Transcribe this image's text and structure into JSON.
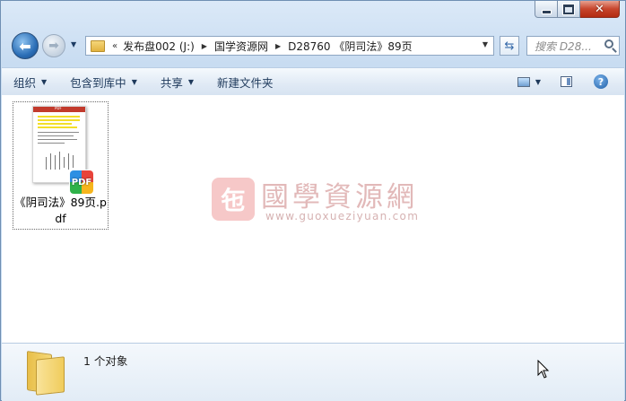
{
  "window": {
    "caption_buttons": {
      "minimize": "",
      "maximize": "",
      "close": "✕"
    }
  },
  "nav": {
    "breadcrumb_chevron": "«",
    "breadcrumb": [
      "发布盘002 (J:)",
      "国学资源网",
      "D28760 《阴司法》89页"
    ],
    "search_placeholder": "搜索 D28..."
  },
  "toolbar": {
    "organize": "组织",
    "include_in_library": "包含到库中",
    "share": "共享",
    "new_folder": "新建文件夹"
  },
  "files": [
    {
      "name": "《阴司法》89页.pdf",
      "badge": "PDF"
    }
  ],
  "watermark": {
    "seal": "㐌",
    "title": "國學資源網",
    "url": "www.guoxueziyuan.com"
  },
  "details": {
    "count": "1 个对象"
  },
  "icons": {
    "back": "back-arrow-icon",
    "forward": "forward-arrow-icon",
    "refresh": "refresh-icon",
    "search": "search-icon",
    "help": "help-icon"
  }
}
